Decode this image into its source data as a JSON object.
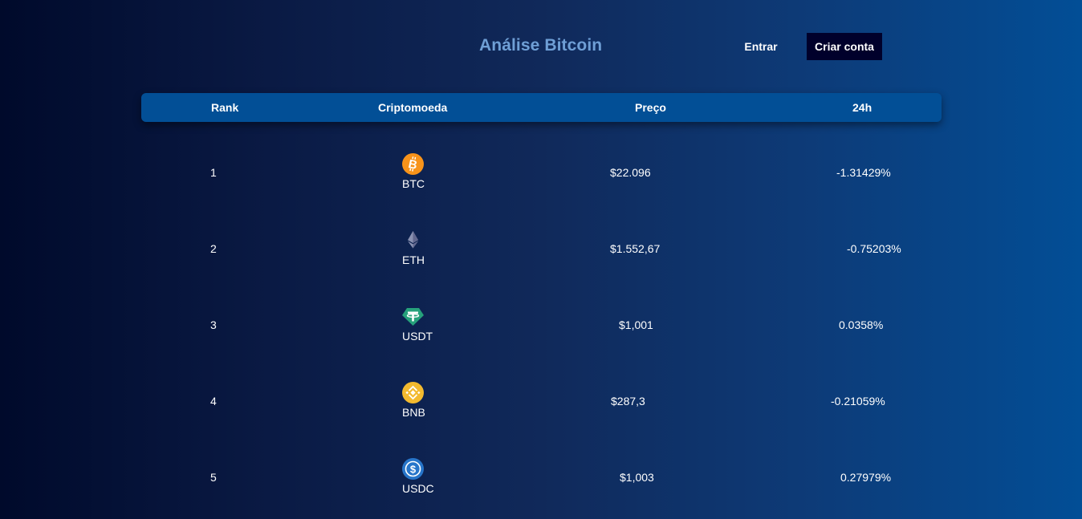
{
  "header": {
    "title": "Análise Bitcoin",
    "login_label": "Entrar",
    "signup_label": "Criar conta"
  },
  "table": {
    "columns": [
      "Rank",
      "Criptomoeda",
      "Preço",
      "24h"
    ],
    "rows": [
      {
        "rank": "1",
        "symbol": "BTC",
        "icon": "bitcoin-icon",
        "price": "$22.096",
        "change": "-1.31429%"
      },
      {
        "rank": "2",
        "symbol": "ETH",
        "icon": "ethereum-icon",
        "price": "$1.552,67",
        "change": "-0.75203%"
      },
      {
        "rank": "3",
        "symbol": "USDT",
        "icon": "tether-icon",
        "price": "$1,001",
        "change": "0.0358%"
      },
      {
        "rank": "4",
        "symbol": "BNB",
        "icon": "bnb-icon",
        "price": "$287,3",
        "change": "-0.21059%"
      },
      {
        "rank": "5",
        "symbol": "USDC",
        "icon": "usdc-icon",
        "price": "$1,003",
        "change": "0.27979%"
      }
    ]
  },
  "colors": {
    "background_start": "#000a2b",
    "background_end": "#024e96",
    "title": "#6f9fd6",
    "table_header": "#024f96",
    "signup_button": "#00002b",
    "btc": "#f7931a",
    "eth": "#62688f",
    "usdt": "#26a17b",
    "bnb": "#f3ba2f",
    "usdc": "#2775ca"
  }
}
